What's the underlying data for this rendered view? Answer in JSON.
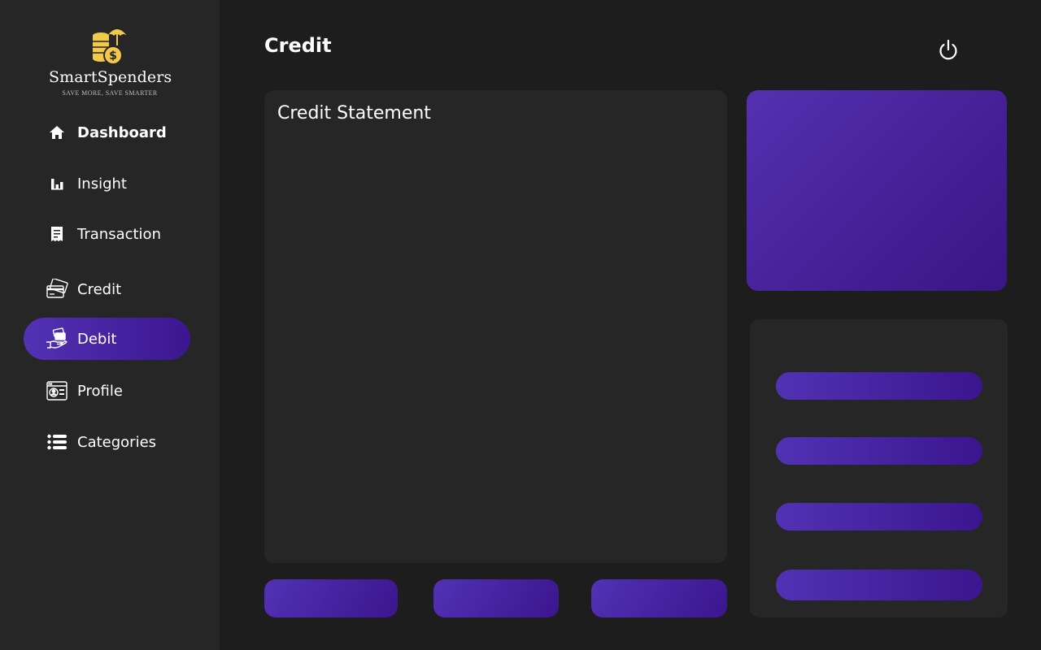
{
  "brand": {
    "name": "SmartSpenders",
    "tagline": "SAVE MORE, SAVE SMARTER",
    "icon": "coins-umbrella-icon"
  },
  "colors": {
    "background": "#1d1d1d",
    "sidebar": "#262626",
    "panel": "#262626",
    "accent_start": "#5232b4",
    "accent_end": "#3b1690",
    "logo_gold": "#f2c94c"
  },
  "sidebar": {
    "items": [
      {
        "label": "Dashboard",
        "icon": "home-icon",
        "bold": true
      },
      {
        "label": "Insight",
        "icon": "bar-chart-icon"
      },
      {
        "label": "Transaction",
        "icon": "receipt-icon"
      },
      {
        "label": "Credit",
        "icon": "credit-cards-icon"
      },
      {
        "label": "Debit",
        "icon": "hand-card-icon",
        "active": true
      },
      {
        "label": "Profile",
        "icon": "id-card-icon"
      },
      {
        "label": "Categories",
        "icon": "list-icon"
      }
    ]
  },
  "header": {
    "title": "Credit",
    "power_icon": "power-icon"
  },
  "main": {
    "statement_title": "Credit Statement"
  }
}
